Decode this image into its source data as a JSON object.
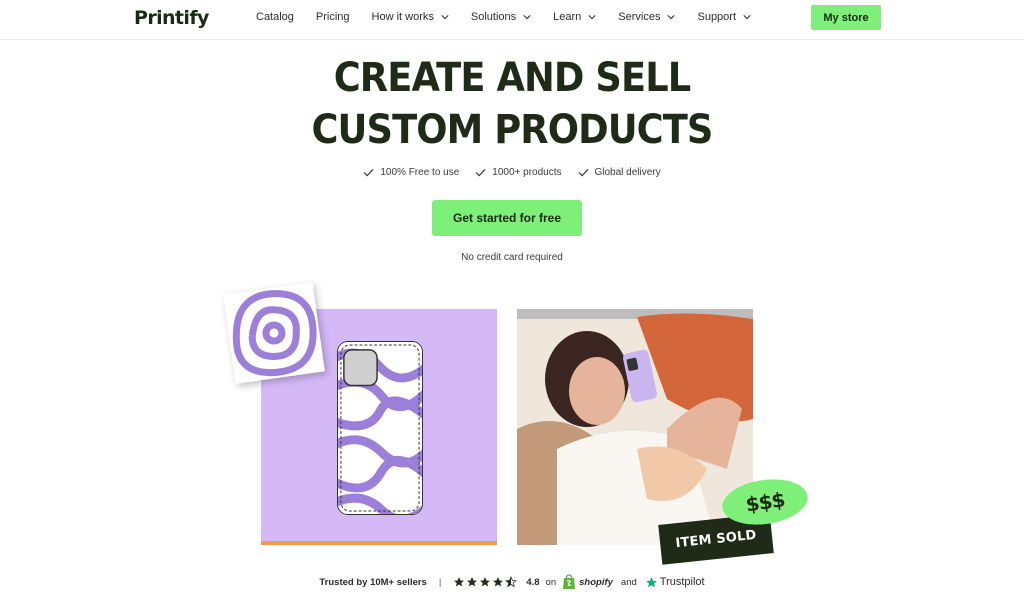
{
  "nav": {
    "logo": "Printify",
    "items": [
      {
        "label": "Catalog",
        "dropdown": false
      },
      {
        "label": "Pricing",
        "dropdown": false
      },
      {
        "label": "How it works",
        "dropdown": true
      },
      {
        "label": "Solutions",
        "dropdown": true
      },
      {
        "label": "Learn",
        "dropdown": true
      },
      {
        "label": "Services",
        "dropdown": true
      },
      {
        "label": "Support",
        "dropdown": true
      }
    ],
    "my_store": "My store"
  },
  "hero": {
    "headline_line1": "CREATE AND SELL",
    "headline_line2": "CUSTOM PRODUCTS",
    "features": [
      "100% Free to use",
      "1000+ products",
      "Global delivery"
    ],
    "cta": "Get started for free",
    "subtext": "No credit card required"
  },
  "badges": {
    "money": "$$$",
    "sold": "ITEM SOLD"
  },
  "trust": {
    "label": "Trusted by 10M+ sellers",
    "separator": "|",
    "rating": "4.8",
    "stars": 4.5,
    "on": "on",
    "shopify": "shopify",
    "and": "and",
    "trustpilot": "Trustpilot"
  },
  "colors": {
    "accent_green": "#7ef07a",
    "dark": "#1f2a17",
    "purple": "#d5b9f7",
    "swirl": "#9b7fd8",
    "orange": "#ef9a4c"
  },
  "icons": [
    "chevron-down-icon",
    "check-icon",
    "star-icon",
    "half-star-icon",
    "shopify-bag-icon",
    "trustpilot-star-icon"
  ]
}
